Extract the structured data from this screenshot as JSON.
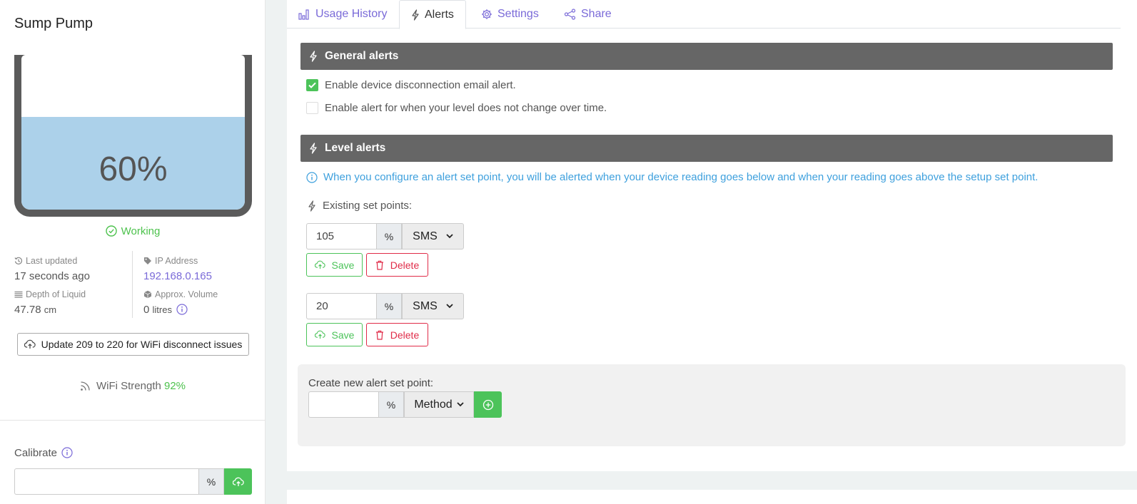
{
  "device": {
    "title": "Sump Pump",
    "level_percent": 60,
    "level_label": "60%",
    "status": "Working",
    "fill_color": "#acd1ea",
    "status_color": "#4dc24d"
  },
  "meta": {
    "last_updated_label": "Last updated",
    "last_updated_value": "17 seconds ago",
    "depth_label": "Depth of Liquid",
    "depth_value": "47.78",
    "depth_unit": "cm",
    "ip_label": "IP Address",
    "ip_value": "192.168.0.165",
    "volume_label": "Approx. Volume",
    "volume_value": "0",
    "volume_unit": "litres"
  },
  "update_button": "Update 209 to 220 for WiFi disconnect issues",
  "wifi": {
    "label": "WiFi Strength",
    "value": "92%"
  },
  "calibrate": {
    "label": "Calibrate",
    "value": "",
    "unit": "%"
  },
  "tabs": [
    {
      "label": "Usage History",
      "icon": "bar-chart-icon",
      "active": false
    },
    {
      "label": "Alerts",
      "icon": "lightning-icon",
      "active": true
    },
    {
      "label": "Settings",
      "icon": "gear-icon",
      "active": false
    },
    {
      "label": "Share",
      "icon": "share-icon",
      "active": false
    }
  ],
  "general_alerts": {
    "title": "General alerts",
    "options": [
      {
        "label": "Enable device disconnection email alert.",
        "checked": true
      },
      {
        "label": "Enable alert for when your level does not change over time.",
        "checked": false
      }
    ]
  },
  "level_alerts": {
    "title": "Level alerts",
    "info": "When you configure an alert set point, you will be alerted when your device reading goes below and when your reading goes above the setup set point.",
    "existing_label": "Existing set points:",
    "set_points": [
      {
        "value": "105",
        "unit": "%",
        "method": "SMS",
        "save_label": "Save",
        "delete_label": "Delete"
      },
      {
        "value": "20",
        "unit": "%",
        "method": "SMS",
        "save_label": "Save",
        "delete_label": "Delete"
      }
    ]
  },
  "create_set_point": {
    "label": "Create new alert set point:",
    "value": "",
    "unit": "%",
    "method_placeholder": "Method"
  },
  "colors": {
    "accent": "#7a6ad8",
    "success": "#4cc35a",
    "danger": "#e02b48",
    "info": "#3ea0dd",
    "section_bar": "#666666"
  }
}
